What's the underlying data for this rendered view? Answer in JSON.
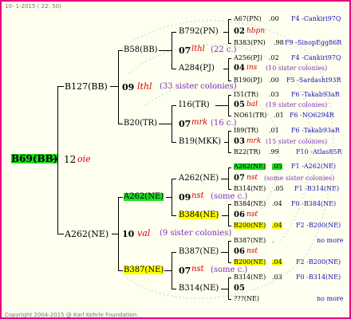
{
  "header": "10- 1-2015 ( 22: 50)",
  "footer": "Copyright 2004-2015 @ Karl Kehrle Foundation.",
  "root": {
    "name": "B69(BB)",
    "year": "12",
    "breeder": "oie"
  },
  "g1": [
    {
      "name": "B127(BB)",
      "year": "09",
      "breeder": "lthl",
      "sisters": "(33 sister colonies)"
    },
    {
      "name": "A262(NE)",
      "year": "10",
      "breeder": "val",
      "sisters": "(9 sister colonies)"
    }
  ],
  "g2": [
    {
      "name": "B58(BB)",
      "year": "07",
      "breeder": "lthl",
      "sisters": "(22 c.)"
    },
    {
      "name": "B20(TR)",
      "year": "07",
      "breeder": "mrk",
      "sisters": "(16 c.)"
    },
    {
      "name": "A262(NE)",
      "year": "09",
      "breeder": "nst",
      "sisters": "(some c.)"
    },
    {
      "name": "B387(NE)",
      "year": "07",
      "breeder": "nst",
      "sisters": "(some c.)"
    }
  ],
  "g3": [
    {
      "name": "B792(PN)",
      "year": "02",
      "breeder": "hbpn"
    },
    {
      "name": "A284(PJ)",
      "year": "04",
      "breeder": "ins",
      "sisters": "(10 sister colonies)"
    },
    {
      "name": "I16(TR)",
      "year": "05",
      "breeder": "bal",
      "sisters": "(19 sister colonies)"
    },
    {
      "name": "B19(MKK)",
      "year": "03",
      "breeder": "mrk",
      "sisters": "(15 sister colonies)"
    },
    {
      "name": "A262(NE)",
      "year": "07",
      "breeder": "nst",
      "sisters": "(some sister colonies)"
    },
    {
      "name": "B384(NE)",
      "year": "06",
      "breeder": "nst"
    },
    {
      "name": "B387(NE)",
      "year": "06",
      "breeder": "nst"
    },
    {
      "name": "B314(NE)",
      "year": "05"
    }
  ],
  "g4": [
    {
      "name": "A67(PN)",
      "year": ".00",
      "breeder": "F4 -Cankiri97Q"
    },
    {
      "name": "B383(PN)",
      "year": ".98",
      "breeder": "F9 -SinopEgg86R"
    },
    {
      "name": "A256(PJ)",
      "year": ".02",
      "breeder": "F4 -Cankiri97Q"
    },
    {
      "name": "B190(PJ)",
      "year": ".00",
      "breeder": "F5 -Sardasht93R"
    },
    {
      "name": "I51(TR)",
      "year": ".03",
      "breeder": "F6 -Takab93aR"
    },
    {
      "name": "NO61(TR)",
      "year": ".01",
      "breeder": "F6 -NO6294R"
    },
    {
      "name": "I89(TR)",
      "year": ".01",
      "breeder": "F6 -Takab93aR"
    },
    {
      "name": "B22(TR)",
      "year": ".99",
      "breeder": "F10 -Atlas85R"
    },
    {
      "name": "A262(NE)",
      "year": ".05",
      "breeder": "F1 -A262(NE)"
    },
    {
      "name": "B314(NE)",
      "year": ".05",
      "breeder": "F1 -B314(NE)"
    },
    {
      "name": "B384(NE)",
      "year": ".04",
      "breeder": "F0 -B384(NE)"
    },
    {
      "name": "B200(NE)",
      "year": ".04",
      "breeder": "F2 -B200(NE)"
    },
    {
      "name": "B387(NE)",
      "year": ".",
      "breeder": "no more"
    },
    {
      "name": "B200(NE)",
      "year": ".04",
      "breeder": "F2 -B200(NE)"
    },
    {
      "name": "B314(NE)",
      "year": ".03",
      "breeder": "F0 -B314(NE)"
    },
    {
      "name": "???(NE)",
      "breeder": "no more"
    }
  ]
}
